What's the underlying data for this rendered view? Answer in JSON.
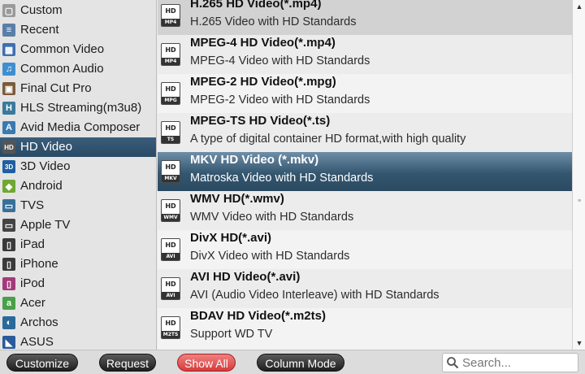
{
  "sidebar": {
    "items": [
      {
        "label": "Custom",
        "icon": "folder-icon",
        "color": "#9a9a9a",
        "glyph": "▢"
      },
      {
        "label": "Recent",
        "icon": "list-icon",
        "color": "#5a7fa8",
        "glyph": "≡"
      },
      {
        "label": "Common Video",
        "icon": "film-icon",
        "color": "#3f6fb0",
        "glyph": "▦"
      },
      {
        "label": "Common Audio",
        "icon": "music-note-icon",
        "color": "#3f8fd0",
        "glyph": "♫"
      },
      {
        "label": "Final Cut Pro",
        "icon": "clapper-icon",
        "color": "#7b5a3a",
        "glyph": "▣"
      },
      {
        "label": "HLS Streaming(m3u8)",
        "icon": "hls-icon",
        "color": "#3a7a9a",
        "glyph": "H"
      },
      {
        "label": "Avid Media Composer",
        "icon": "avid-icon",
        "color": "#3a7ab0",
        "glyph": "A"
      },
      {
        "label": "HD Video",
        "icon": "hd-icon",
        "color": "#555555",
        "glyph": "HD"
      },
      {
        "label": "3D Video",
        "icon": "3d-icon",
        "color": "#1f5fa0",
        "glyph": "3D"
      },
      {
        "label": "Android",
        "icon": "android-icon",
        "color": "#6fa832",
        "glyph": "◆"
      },
      {
        "label": "TVS",
        "icon": "tv-icon",
        "color": "#3a6f9a",
        "glyph": "▭"
      },
      {
        "label": "Apple TV",
        "icon": "apple-tv-icon",
        "color": "#444444",
        "glyph": "▭"
      },
      {
        "label": "iPad",
        "icon": "ipad-icon",
        "color": "#3a3a3a",
        "glyph": "▯"
      },
      {
        "label": "iPhone",
        "icon": "iphone-icon",
        "color": "#3a3a3a",
        "glyph": "▯"
      },
      {
        "label": "iPod",
        "icon": "ipod-icon",
        "color": "#a33a7a",
        "glyph": "▯"
      },
      {
        "label": "Acer",
        "icon": "acer-icon",
        "color": "#4aa04a",
        "glyph": "a"
      },
      {
        "label": "Archos",
        "icon": "archos-icon",
        "color": "#2a6a9a",
        "glyph": "◐"
      },
      {
        "label": "ASUS",
        "icon": "asus-icon",
        "color": "#2a5a9a",
        "glyph": "◣"
      }
    ],
    "selected_index": 7
  },
  "formats": [
    {
      "name": "H.265 HD Video(*.mp4)",
      "desc": "H.265 Video with HD Standards",
      "badge": "MP4",
      "icon": "h265-format-icon"
    },
    {
      "name": "MPEG-4 HD Video(*.mp4)",
      "desc": "MPEG-4 Video with HD Standards",
      "badge": "MP4",
      "icon": "mp4-format-icon"
    },
    {
      "name": "MPEG-2 HD Video(*.mpg)",
      "desc": "MPEG-2 Video with HD Standards",
      "badge": "MPG",
      "icon": "mpg-format-icon"
    },
    {
      "name": "MPEG-TS HD Video(*.ts)",
      "desc": "A type of digital container HD format,with high quality",
      "badge": "TS",
      "icon": "ts-format-icon"
    },
    {
      "name": "MKV HD Video (*.mkv)",
      "desc": "Matroska Video with HD Standards",
      "badge": "MKV",
      "icon": "mkv-format-icon"
    },
    {
      "name": "WMV HD(*.wmv)",
      "desc": "WMV Video with HD Standards",
      "badge": "WMV",
      "icon": "wmv-format-icon"
    },
    {
      "name": "DivX HD(*.avi)",
      "desc": "DivX Video with HD Standards",
      "badge": "AVI",
      "icon": "divx-format-icon"
    },
    {
      "name": "AVI HD Video(*.avi)",
      "desc": "AVI (Audio Video Interleave) with HD Standards",
      "badge": "AVI",
      "icon": "avi-format-icon"
    },
    {
      "name": "BDAV HD Video(*.m2ts)",
      "desc": "Support WD TV",
      "badge": "M2TS",
      "icon": "m2ts-format-icon"
    }
  ],
  "selected_format_index": 4,
  "hd_badge_text": "HD",
  "bottombar": {
    "customize_label": "Customize",
    "request_label": "Request",
    "show_all_label": "Show All",
    "column_mode_label": "Column Mode",
    "search_placeholder": "Search..."
  },
  "colors": {
    "selection": "#2b4a62",
    "show_all_active": "#d63a3a"
  }
}
